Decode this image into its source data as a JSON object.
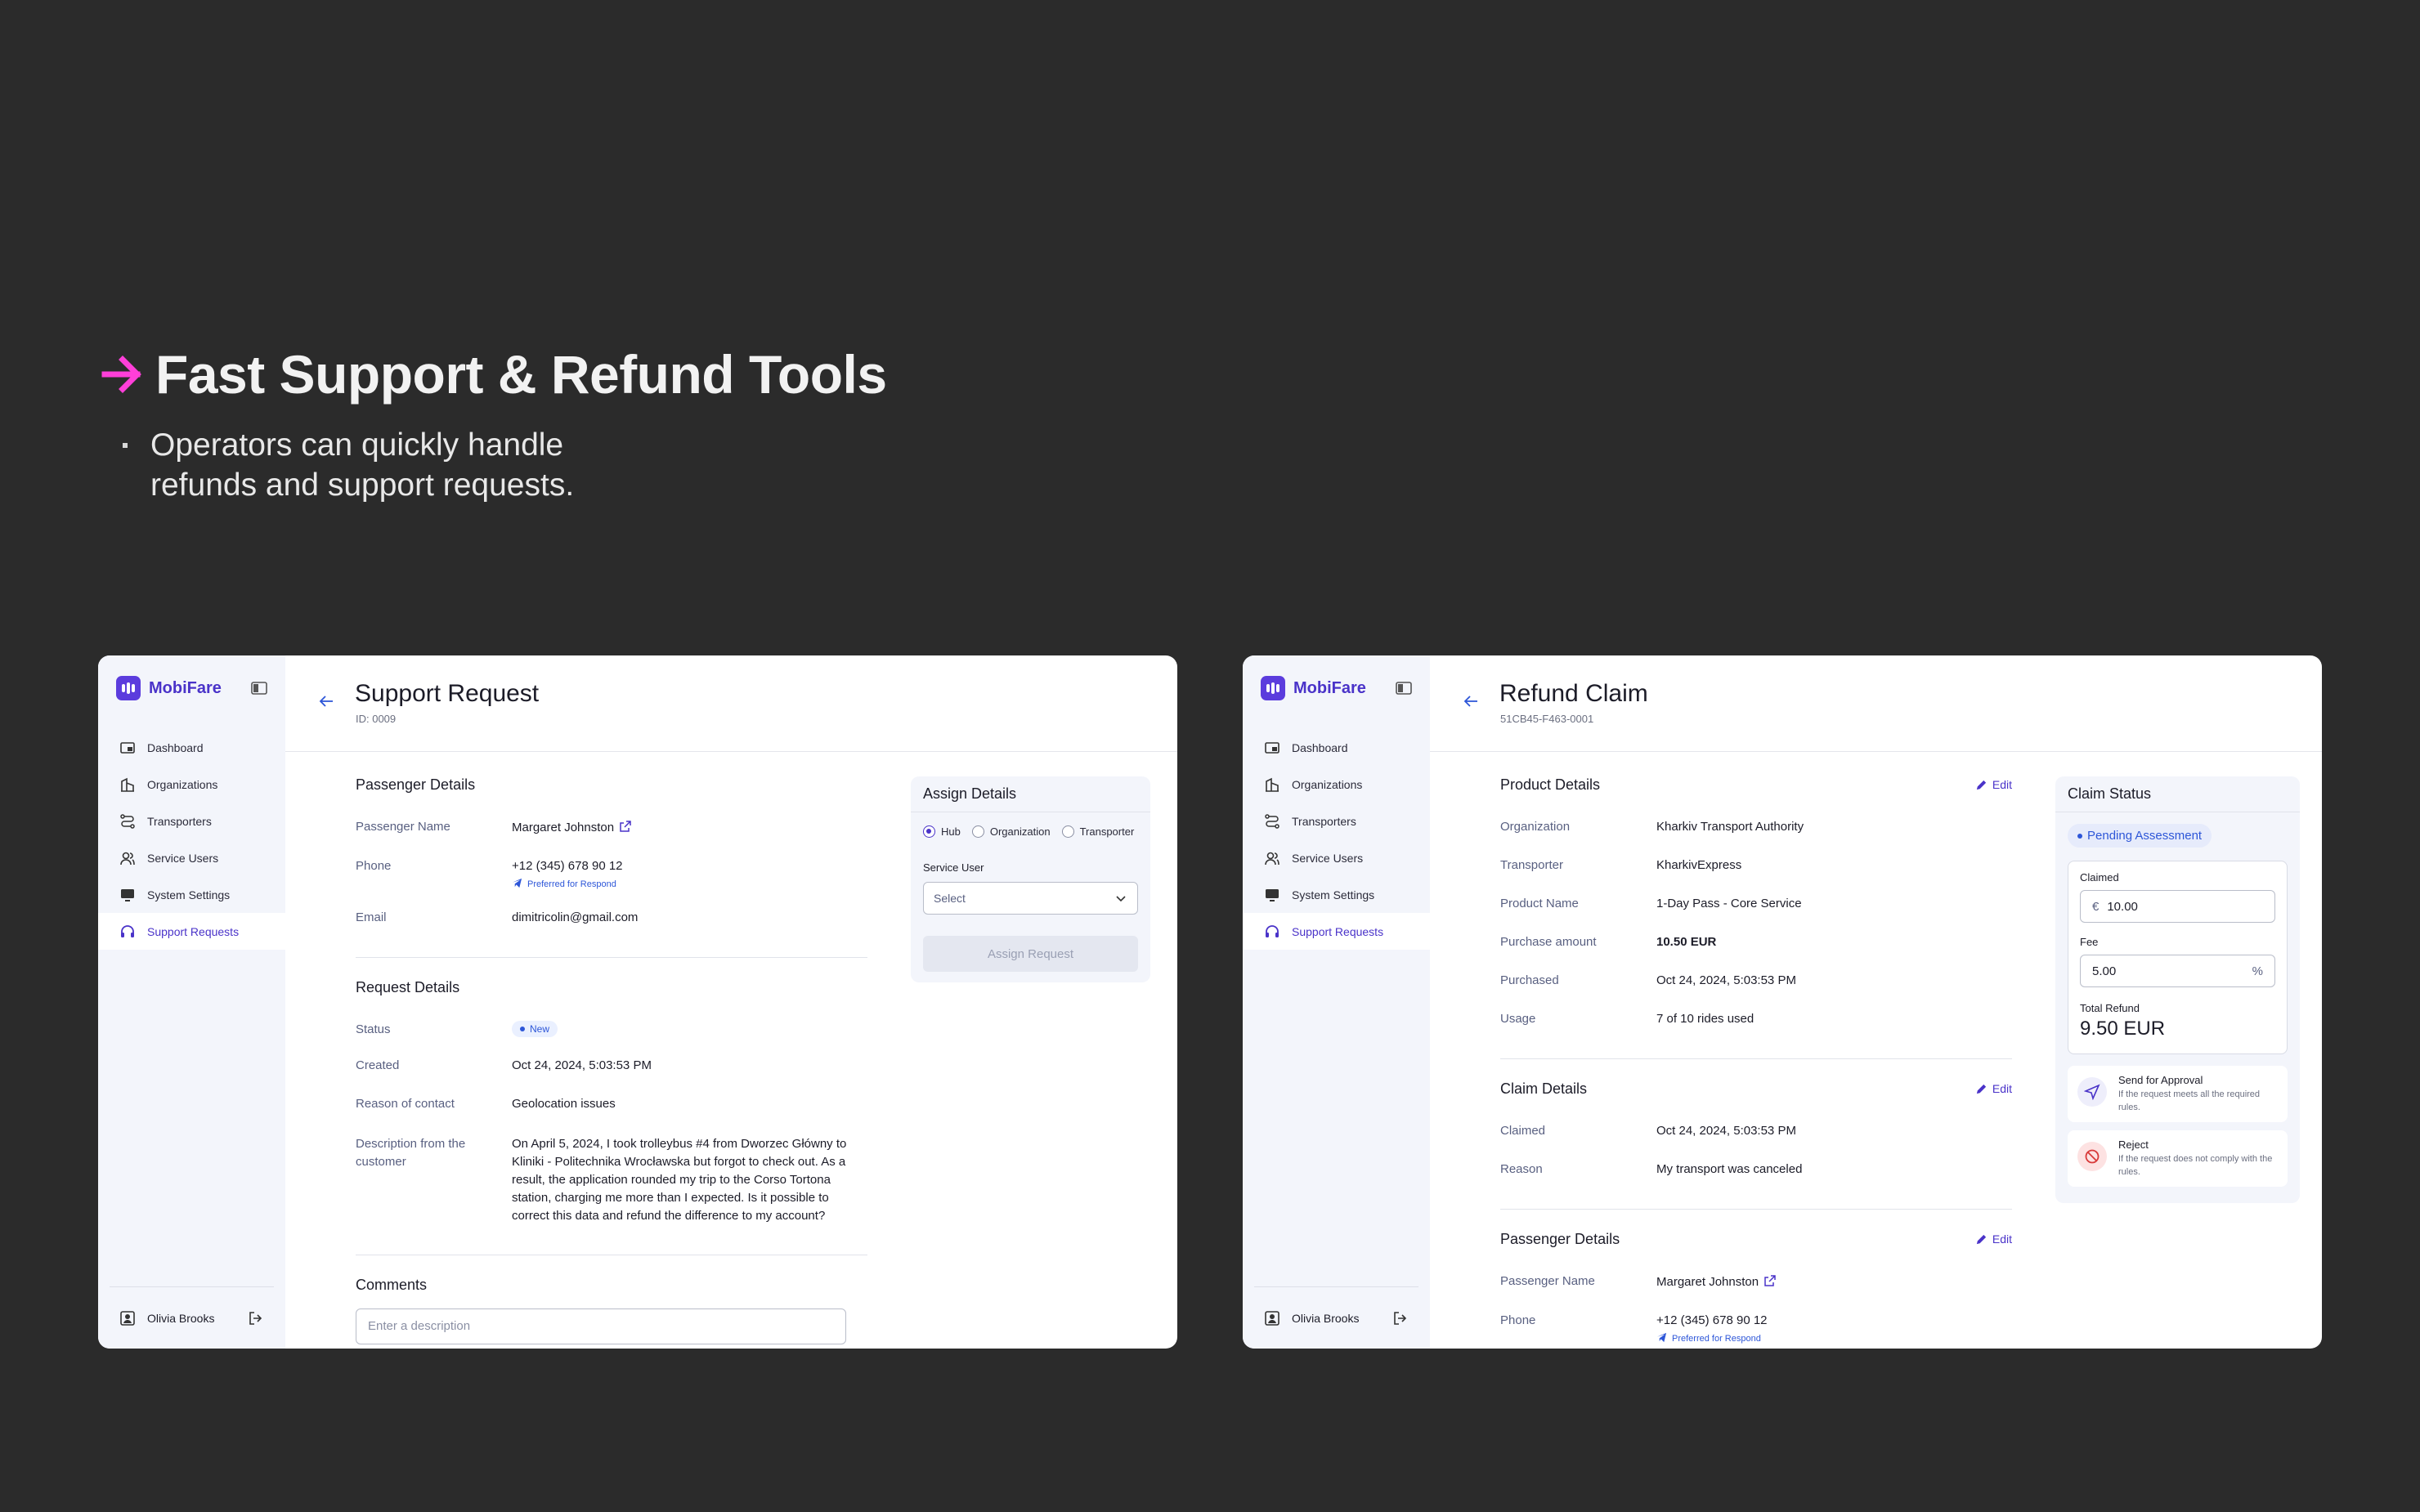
{
  "hero": {
    "title": "Fast Support & Refund Tools",
    "bullet": "Operators can quickly handle refunds and support requests.",
    "accent_color": "#ff3fd9"
  },
  "brand": {
    "name": "MobiFare",
    "color": "#5b3cdd"
  },
  "nav_items": [
    {
      "label": "Dashboard",
      "icon": "dashboard-icon"
    },
    {
      "label": "Organizations",
      "icon": "building-icon"
    },
    {
      "label": "Transporters",
      "icon": "route-icon"
    },
    {
      "label": "Service Users",
      "icon": "users-icon"
    },
    {
      "label": "System Settings",
      "icon": "settings-icon"
    },
    {
      "label": "Support Requests",
      "icon": "headset-icon",
      "active": true
    }
  ],
  "user": {
    "name": "Olivia Brooks"
  },
  "support": {
    "title": "Support Request",
    "id": "ID: 0009",
    "passenger": {
      "heading": "Passenger Details",
      "name_label": "Passenger Name",
      "name": "Margaret Johnston",
      "phone_label": "Phone",
      "phone": "+12 (345) 678 90 12",
      "preferred": "Preferred for Respond",
      "email_label": "Email",
      "email": "dimitricolin@gmail.com"
    },
    "request": {
      "heading": "Request Details",
      "status_label": "Status",
      "status": "New",
      "created_label": "Created",
      "created": "Oct 24, 2024, 5:03:53 PM",
      "reason_label": "Reason of contact",
      "reason": "Geolocation issues",
      "desc_label": "Description from the customer",
      "description": "On April 5, 2024, I took trolleybus #4 from Dworzec Główny to Kliniki - Politechnika Wrocławska but forgot to check out. As a result, the application rounded my trip to the Corso Tortona station, charging me more than I expected. Is it possible to correct this data and refund the difference to my account?"
    },
    "comments": {
      "heading": "Comments",
      "placeholder": "Enter a description"
    },
    "assign": {
      "heading": "Assign Details",
      "options": [
        "Hub",
        "Organization",
        "Transporter"
      ],
      "service_user_label": "Service User",
      "select_placeholder": "Select",
      "button": "Assign Request"
    }
  },
  "refund": {
    "title": "Refund Claim",
    "id": "51CB45-F463-0001",
    "edit_label": "Edit",
    "product": {
      "heading": "Product Details",
      "org_label": "Organization",
      "org": "Kharkiv Transport Authority",
      "transporter_label": "Transporter",
      "transporter": "KharkivExpress",
      "product_label": "Product Name",
      "product": "1-Day Pass - Core Service",
      "amount_label": "Purchase amount",
      "amount": "10.50 EUR",
      "purchased_label": "Purchased",
      "purchased": "Oct 24, 2024, 5:03:53 PM",
      "usage_label": "Usage",
      "usage": "7 of 10 rides used"
    },
    "claim": {
      "heading": "Claim Details",
      "claimed_label": "Claimed",
      "claimed": "Oct 24, 2024, 5:03:53 PM",
      "reason_label": "Reason",
      "reason": "My transport was canceled"
    },
    "passenger": {
      "heading": "Passenger Details",
      "name_label": "Passenger Name",
      "name": "Margaret Johnston",
      "phone_label": "Phone",
      "phone": "+12 (345) 678 90 12",
      "preferred": "Preferred for Respond"
    },
    "status": {
      "heading": "Claim Status",
      "badge": "Pending Assessment",
      "claimed_label": "Claimed",
      "currency": "€",
      "claimed_value": "10.00",
      "fee_label": "Fee",
      "fee_value": "5.00",
      "fee_unit": "%",
      "total_label": "Total Refund",
      "total_value": "9.50 EUR",
      "approve_title": "Send for Approval",
      "approve_desc": "If the request meets all the required rules.",
      "reject_title": "Reject",
      "reject_desc": "If the request does not comply with the rules."
    }
  }
}
